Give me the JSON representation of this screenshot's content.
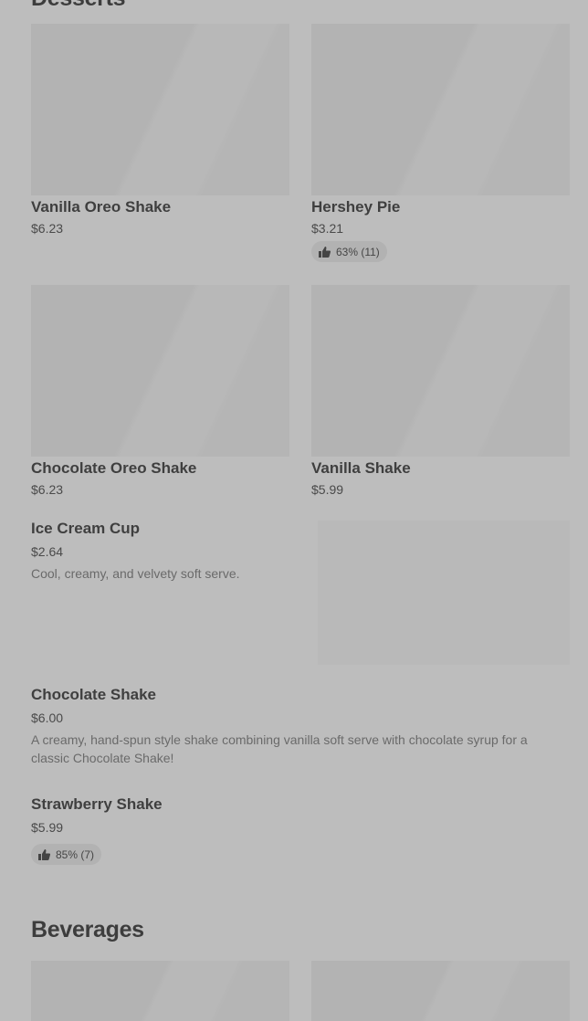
{
  "sections": {
    "desserts_title": "Desserts",
    "beverages_title": "Beverages"
  },
  "grid_items": [
    {
      "name": "Vanilla Oreo Shake",
      "price": "$6.23"
    },
    {
      "name": "Hershey Pie",
      "price": "$3.21",
      "rating": "63% (11)"
    },
    {
      "name": "Chocolate Oreo Shake",
      "price": "$6.23"
    },
    {
      "name": "Vanilla Shake",
      "price": "$5.99"
    }
  ],
  "list_items": [
    {
      "name": "Ice Cream Cup",
      "price": "$2.64",
      "description": "Cool, creamy, and velvety soft serve."
    },
    {
      "name": "Chocolate Shake",
      "price": "$6.00",
      "description": "A creamy, hand-spun style shake combining vanilla soft serve with chocolate syrup for a classic Chocolate Shake!"
    },
    {
      "name": "Strawberry Shake",
      "price": "$5.99",
      "rating": "85% (7)"
    }
  ],
  "icons": {
    "thumbs_up": "thumbs-up-icon"
  },
  "colors": {
    "background": "#bdbdbd",
    "image_placeholder": "#b3b3b3",
    "text_primary": "#3f3f3f",
    "text_secondary": "#6a6a6a"
  }
}
